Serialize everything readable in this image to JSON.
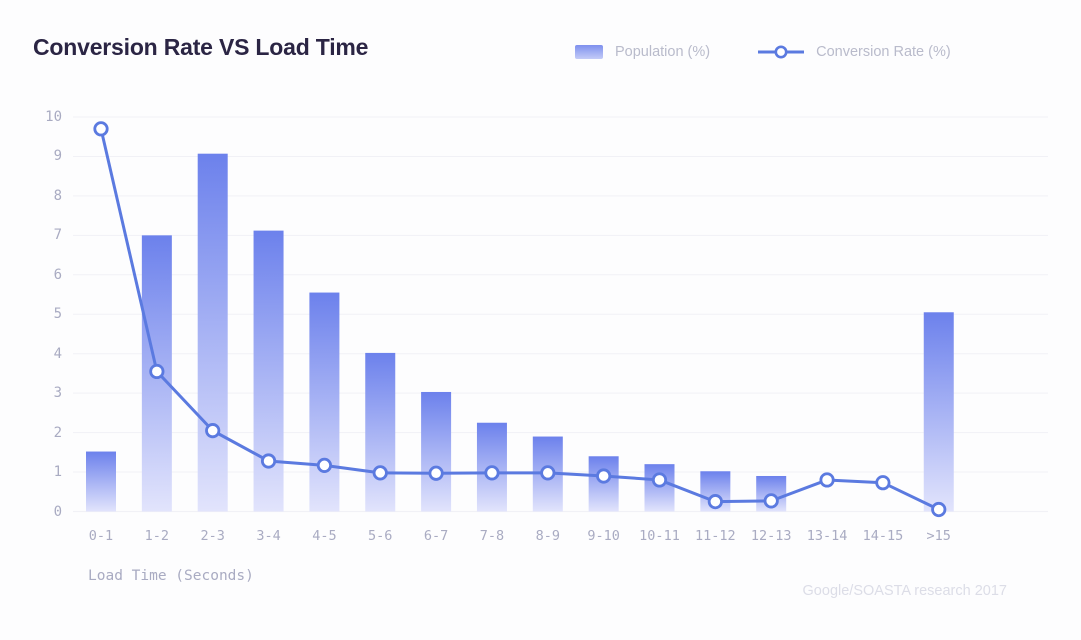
{
  "header": {
    "title": "Conversion Rate VS Load Time"
  },
  "legend": {
    "items": [
      {
        "label": "Population (%)",
        "marker": "gradient-square",
        "color": "#7e90ee"
      },
      {
        "label": "Conversion Rate (%)",
        "marker": "line-circle",
        "color": "#5b7ae0"
      }
    ]
  },
  "footer": {
    "source_note": "Google/SOASTA research 2017"
  },
  "axis": {
    "x_title": "Load Time (Seconds)",
    "y_ticks": [
      "0",
      "1",
      "2",
      "3",
      "4",
      "5",
      "6",
      "7",
      "8",
      "9",
      "10"
    ]
  },
  "colors": {
    "background": "#fdfdfe",
    "title": "#2b2544",
    "tick_text": "#a9abc2",
    "legend_text": "#b9bbcb",
    "gridline": "#f1f1f6",
    "bar_top": "#6c81ec",
    "bar_bottom": "#e0e3fb",
    "line": "#5b7ae0",
    "marker_fill": "#ffffff",
    "footer_text": "#dcdde7"
  },
  "chart_data": {
    "type": "bar",
    "title": "Conversion Rate VS Load Time",
    "xlabel": "Load Time (Seconds)",
    "ylabel": "",
    "ylim": [
      0,
      10
    ],
    "grid": true,
    "legend_position": "top-right",
    "annotation": "Google/SOASTA research 2017",
    "categories": [
      "0-1",
      "1-2",
      "2-3",
      "3-4",
      "4-5",
      "5-6",
      "6-7",
      "7-8",
      "8-9",
      "9-10",
      "10-11",
      "11-12",
      "12-13",
      "13-14",
      "14-15",
      ">15"
    ],
    "series": [
      {
        "name": "Population (%)",
        "type": "bar",
        "values": [
          1.52,
          7.0,
          9.07,
          7.12,
          5.55,
          4.02,
          3.03,
          2.25,
          1.9,
          1.4,
          1.2,
          1.02,
          0.9,
          0,
          0,
          5.05
        ]
      },
      {
        "name": "Conversion Rate (%)",
        "type": "line",
        "values": [
          9.7,
          3.55,
          2.05,
          1.28,
          1.17,
          0.98,
          0.97,
          0.98,
          0.98,
          0.9,
          0.8,
          0.25,
          0.27,
          0.8,
          0.73,
          0.05
        ]
      }
    ]
  }
}
